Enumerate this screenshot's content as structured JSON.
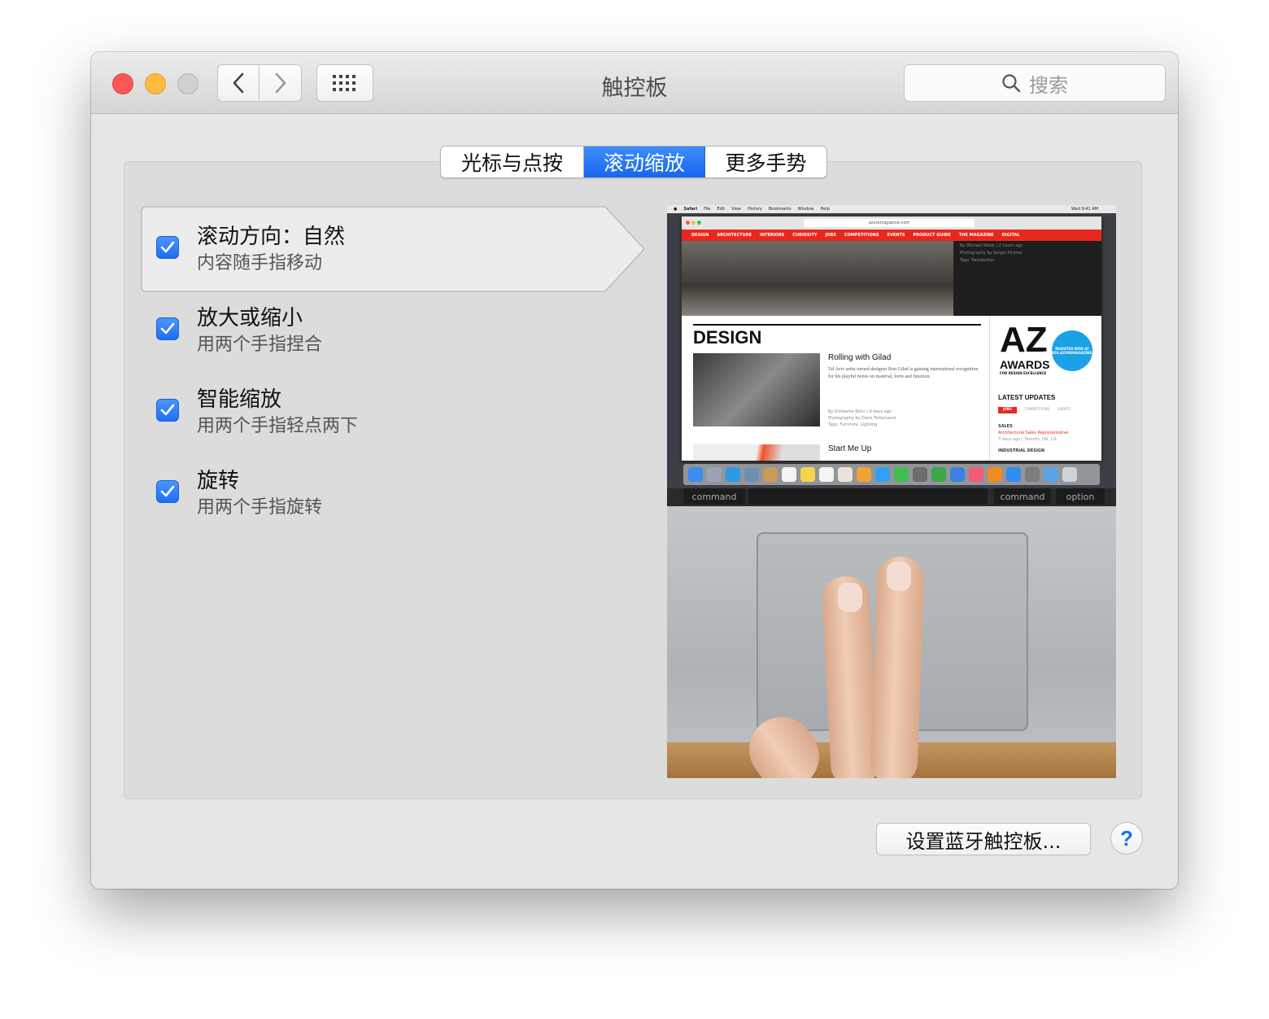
{
  "window": {
    "title": "触控板"
  },
  "toolbar": {
    "back_icon": "chevron-left-icon",
    "forward_icon": "chevron-right-icon",
    "grid_icon": "show-all-grid-icon",
    "search": {
      "icon": "search-icon",
      "placeholder": "搜索"
    }
  },
  "tabs": [
    {
      "label": "光标与点按",
      "selected": false
    },
    {
      "label": "滚动缩放",
      "selected": true
    },
    {
      "label": "更多手势",
      "selected": false
    }
  ],
  "options": [
    {
      "title": "滚动方向：自然",
      "description": "内容随手指移动",
      "checked": true,
      "highlighted": true
    },
    {
      "title": "放大或缩小",
      "description": "用两个手指捏合",
      "checked": true,
      "highlighted": false
    },
    {
      "title": "智能缩放",
      "description": "用两个手指轻点两下",
      "checked": true,
      "highlighted": false
    },
    {
      "title": "旋转",
      "description": "用两个手指旋转",
      "checked": true,
      "highlighted": false
    }
  ],
  "preview": {
    "menubar": [
      "Safari",
      "File",
      "Edit",
      "View",
      "History",
      "Bookmarks",
      "Window",
      "Help"
    ],
    "clock": "Wed 9:41 AM",
    "url": "azuremagazine.com",
    "site_nav": [
      "DESIGN",
      "ARCHITECTURE",
      "INTERIORS",
      "CURIOSITY",
      "JOBS",
      "COMPETITIONS",
      "EVENTS",
      "PRODUCT GUIDE",
      "THE MAGAZINE",
      "DIGITAL"
    ],
    "hero_meta": [
      "By Michael Webb | 2 hours ago",
      "Photography by Sergio Pirrone",
      "Tags: Residential"
    ],
    "section": "DESIGN",
    "article1": {
      "title": "Rolling with Gilad",
      "body": "Tel Aviv artist turned designer Ron Gilad is gaining international recognition for his playful twists on material, form and function.",
      "meta": [
        "By Kimberlie Birks | 4 days ago",
        "Photography by Dario Tettamanzi",
        "Tags: Furniture, Lighting"
      ]
    },
    "article2": {
      "title": "Start Me Up"
    },
    "ad": {
      "logo": "AZ",
      "awards": "AWARDS",
      "tagline": "FOR DESIGN EXCELLENCE",
      "badge": "REGISTER NOW AT AWARDS.AZUREMAGAZINE.COM"
    },
    "latest": {
      "heading": "LATEST UPDATES",
      "tabs": [
        "JOBS",
        "COMPETITIONS",
        "EVENTS"
      ],
      "category": "SALES",
      "job": "Architectural Sales Representative",
      "job_meta": "3 days ago | Toronto, ON, CA",
      "next_category": "INDUSTRIAL DESIGN"
    },
    "keys": {
      "left_command": "command",
      "right_command": "command",
      "option": "option"
    }
  },
  "bottom": {
    "bluetooth_button": "设置蓝牙触控板...",
    "help_label": "?"
  },
  "colors": {
    "accent": "#1d6ff0",
    "close": "#fc5753",
    "minimize": "#fdbc40",
    "zoom_disabled": "#d0d0d0"
  }
}
